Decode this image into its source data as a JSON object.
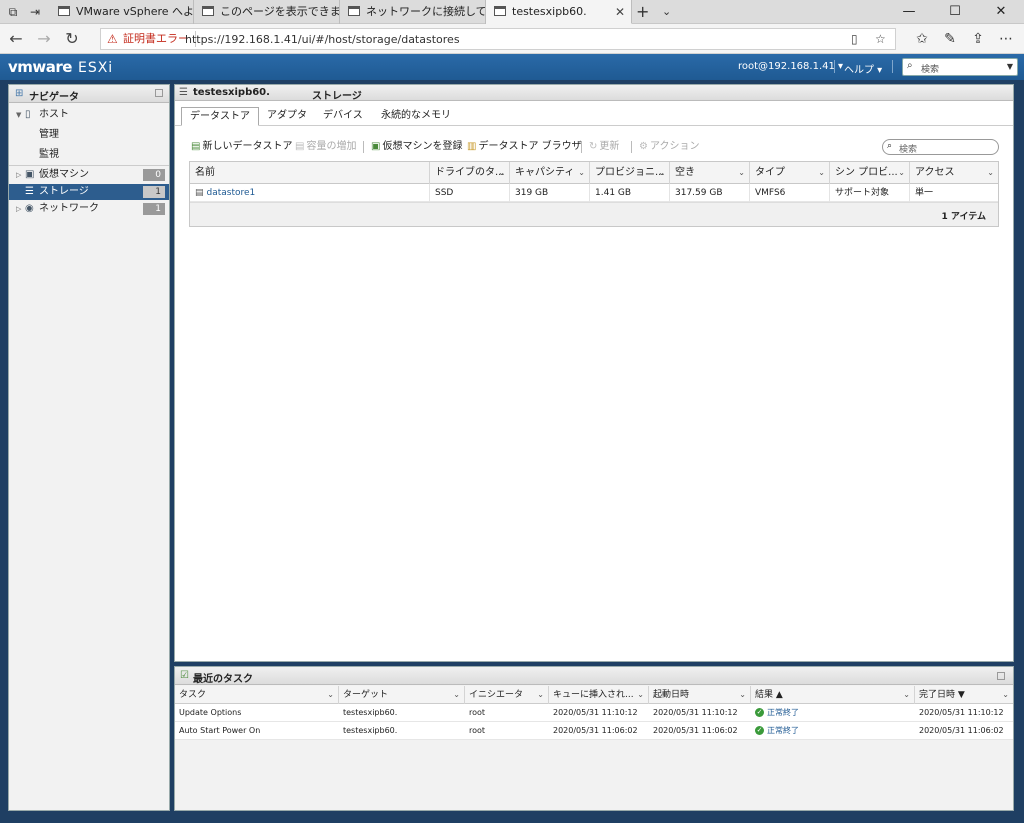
{
  "browser": {
    "tabs": [
      {
        "label": "VMware vSphere へようこそ"
      },
      {
        "label": "このページを表示できません"
      },
      {
        "label": "ネットワークに接続していません"
      },
      {
        "label": "testesxipb60."
      }
    ],
    "cert_error": "証明書エラー",
    "url": "https://192.168.1.41/ui/#/host/storage/datastores"
  },
  "header": {
    "brand": "vmware",
    "product": "ESXi",
    "user": "root@192.168.1.41 ▾",
    "help": "ヘルプ ▾",
    "search_placeholder": "検索"
  },
  "navigator": {
    "title": "ナビゲータ",
    "host": "ホスト",
    "manage": "管理",
    "monitor": "監視",
    "items": [
      {
        "label": "仮想マシン",
        "count": "0"
      },
      {
        "label": "ストレージ",
        "count": "1"
      },
      {
        "label": "ネットワーク",
        "count": "1"
      }
    ]
  },
  "main": {
    "host": "testesxipb60.",
    "title": "ストレージ",
    "tabs": [
      "データストア",
      "アダプタ",
      "デバイス",
      "永続的なメモリ"
    ],
    "toolbar": {
      "new_datastore": "新しいデータストア",
      "increase": "容量の増加",
      "register_vm": "仮想マシンを登録",
      "browser": "データストア ブラウザ",
      "refresh": "更新",
      "actions": "アクション"
    },
    "search_placeholder": "検索",
    "columns": [
      "名前",
      "ドライブのタ...",
      "キャパシティ",
      "プロビジョニ...",
      "空き",
      "タイプ",
      "シン プロビ...",
      "アクセス"
    ],
    "rows": [
      [
        "datastore1",
        "SSD",
        "319 GB",
        "1.41 GB",
        "317.59 GB",
        "VMFS6",
        "サポート対象",
        "単一"
      ]
    ],
    "item_count": "1 アイテム"
  },
  "tasks": {
    "title": "最近のタスク",
    "columns": [
      "タスク",
      "ターゲット",
      "イニシエータ",
      "キューに挿入され...",
      "起動日時",
      "結果 ▲",
      "完了日時 ▼"
    ],
    "rows": [
      [
        "Update Options",
        "testesxipb60.",
        "root",
        "2020/05/31 11:10:12",
        "2020/05/31 11:10:12",
        "正常終了",
        "2020/05/31 11:10:12"
      ],
      [
        "Auto Start Power On",
        "testesxipb60.",
        "root",
        "2020/05/31 11:06:02",
        "2020/05/31 11:06:02",
        "正常終了",
        "2020/05/31 11:06:02"
      ]
    ]
  }
}
